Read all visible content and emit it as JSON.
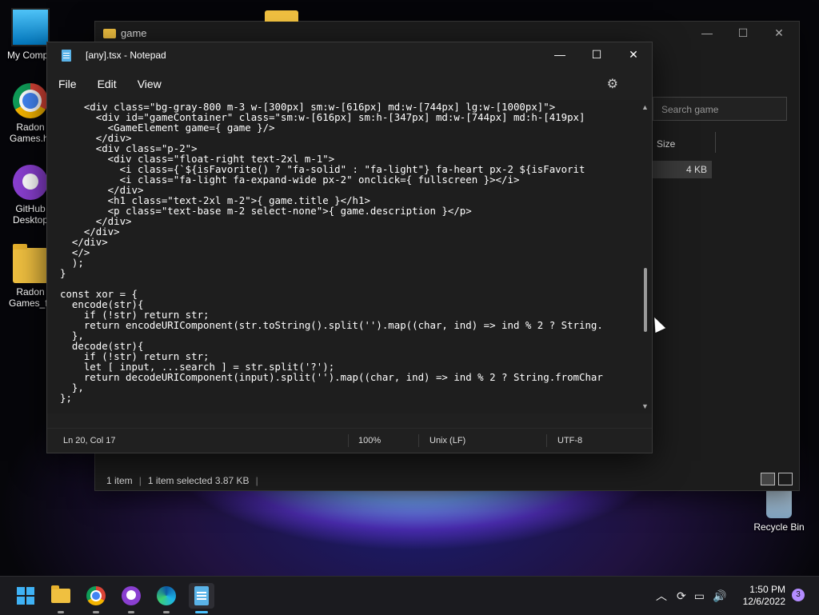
{
  "desktop": {
    "icons": [
      {
        "label": "My Compu",
        "icon": "pc-icon"
      },
      {
        "label": "Radon Games.ht",
        "icon": "chrome-icon"
      },
      {
        "label": "GitHub Desktop",
        "icon": "github-icon"
      },
      {
        "label": "Radon Games_fil",
        "icon": "folder-icon"
      },
      {
        "label": "Recycle Bin",
        "icon": "recycle-bin-icon"
      }
    ]
  },
  "explorer": {
    "title": "game",
    "controls": {
      "minimize": "—",
      "maximize": "☐",
      "close": "✕"
    },
    "search_placeholder": "Search game",
    "column_size": "Size",
    "file_size": "4 KB",
    "status_items": "1 item",
    "status_selected": "1 item selected  3.87 KB",
    "status_sep": "|"
  },
  "notepad": {
    "title": "[any].tsx - Notepad",
    "controls": {
      "minimize": "—",
      "maximize": "☐",
      "close": "✕"
    },
    "menu": {
      "file": "File",
      "edit": "Edit",
      "view": "View"
    },
    "code": "    <div class=\"bg-gray-800 m-3 w-[300px] sm:w-[616px] md:w-[744px] lg:w-[1000px]\">\n      <div id=\"gameContainer\" class=\"sm:w-[616px] sm:h-[347px] md:w-[744px] md:h-[419px]\n        <GameElement game={ game }/>\n      </div>\n      <div class=\"p-2\">\n        <div class=\"float-right text-2xl m-1\">\n          <i class={`${isFavorite() ? \"fa-solid\" : \"fa-light\"} fa-heart px-2 ${isFavorit\n          <i class=\"fa-light fa-expand-wide px-2\" onclick={ fullscreen }></i>\n        </div>\n        <h1 class=\"text-2xl m-2\">{ game.title }</h1>\n        <p class=\"text-base m-2 select-none\">{ game.description }</p>\n      </div>\n    </div>\n  </div>\n  </>\n  );\n}\n\nconst xor = {\n  encode(str){\n    if (!str) return str;\n    return encodeURIComponent(str.toString().split('').map((char, ind) => ind % 2 ? String.\n  },\n  decode(str){\n    if (!str) return str;\n    let [ input, ...search ] = str.split('?');\n    return decodeURIComponent(input).split('').map((char, ind) => ind % 2 ? String.fromChar\n  },\n};",
    "status": {
      "position": "Ln 20, Col 17",
      "zoom": "100%",
      "line_ending": "Unix (LF)",
      "encoding": "UTF-8"
    }
  },
  "taskbar": {
    "apps": [
      "start-icon",
      "file-explorer-icon",
      "chrome-icon",
      "github-desktop-icon",
      "edge-icon",
      "notepad-icon"
    ],
    "active_app": "notepad-icon",
    "time": "1:50 PM",
    "date": "12/6/2022",
    "notification_count": "3",
    "tray": {
      "chevron": "︿",
      "speaker": "🔊"
    }
  }
}
